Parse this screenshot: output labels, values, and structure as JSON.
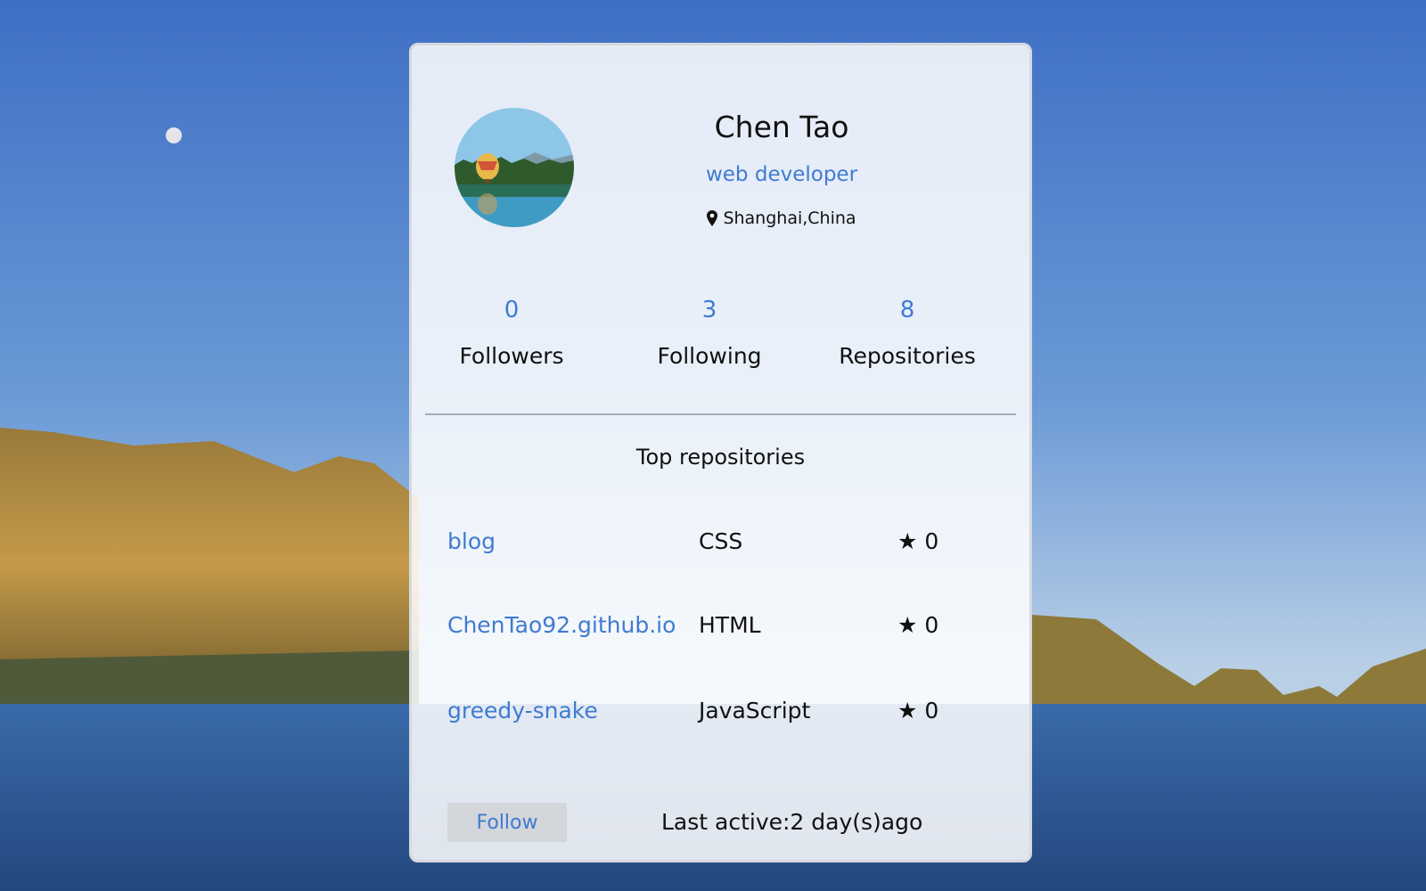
{
  "profile": {
    "name": "Chen Tao",
    "role": "web developer",
    "location": "Shanghai,China"
  },
  "stats": [
    {
      "value": "0",
      "label": "Followers"
    },
    {
      "value": "3",
      "label": "Following"
    },
    {
      "value": "8",
      "label": "Repositories"
    }
  ],
  "repos_title": "Top repositories",
  "repos": [
    {
      "name": "blog",
      "language": "CSS",
      "stars": "0"
    },
    {
      "name": "ChenTao92.github.io",
      "language": "HTML",
      "stars": "0"
    },
    {
      "name": "greedy-snake",
      "language": "JavaScript",
      "stars": "0"
    }
  ],
  "footer": {
    "follow_label": "Follow",
    "last_active": "Last active:2 day(s)ago"
  },
  "icons": {
    "location": "map-pin-icon",
    "star": "star-icon"
  },
  "colors": {
    "accent": "#3f7bd1",
    "text": "#111111",
    "button_bg": "#d3d6da"
  }
}
